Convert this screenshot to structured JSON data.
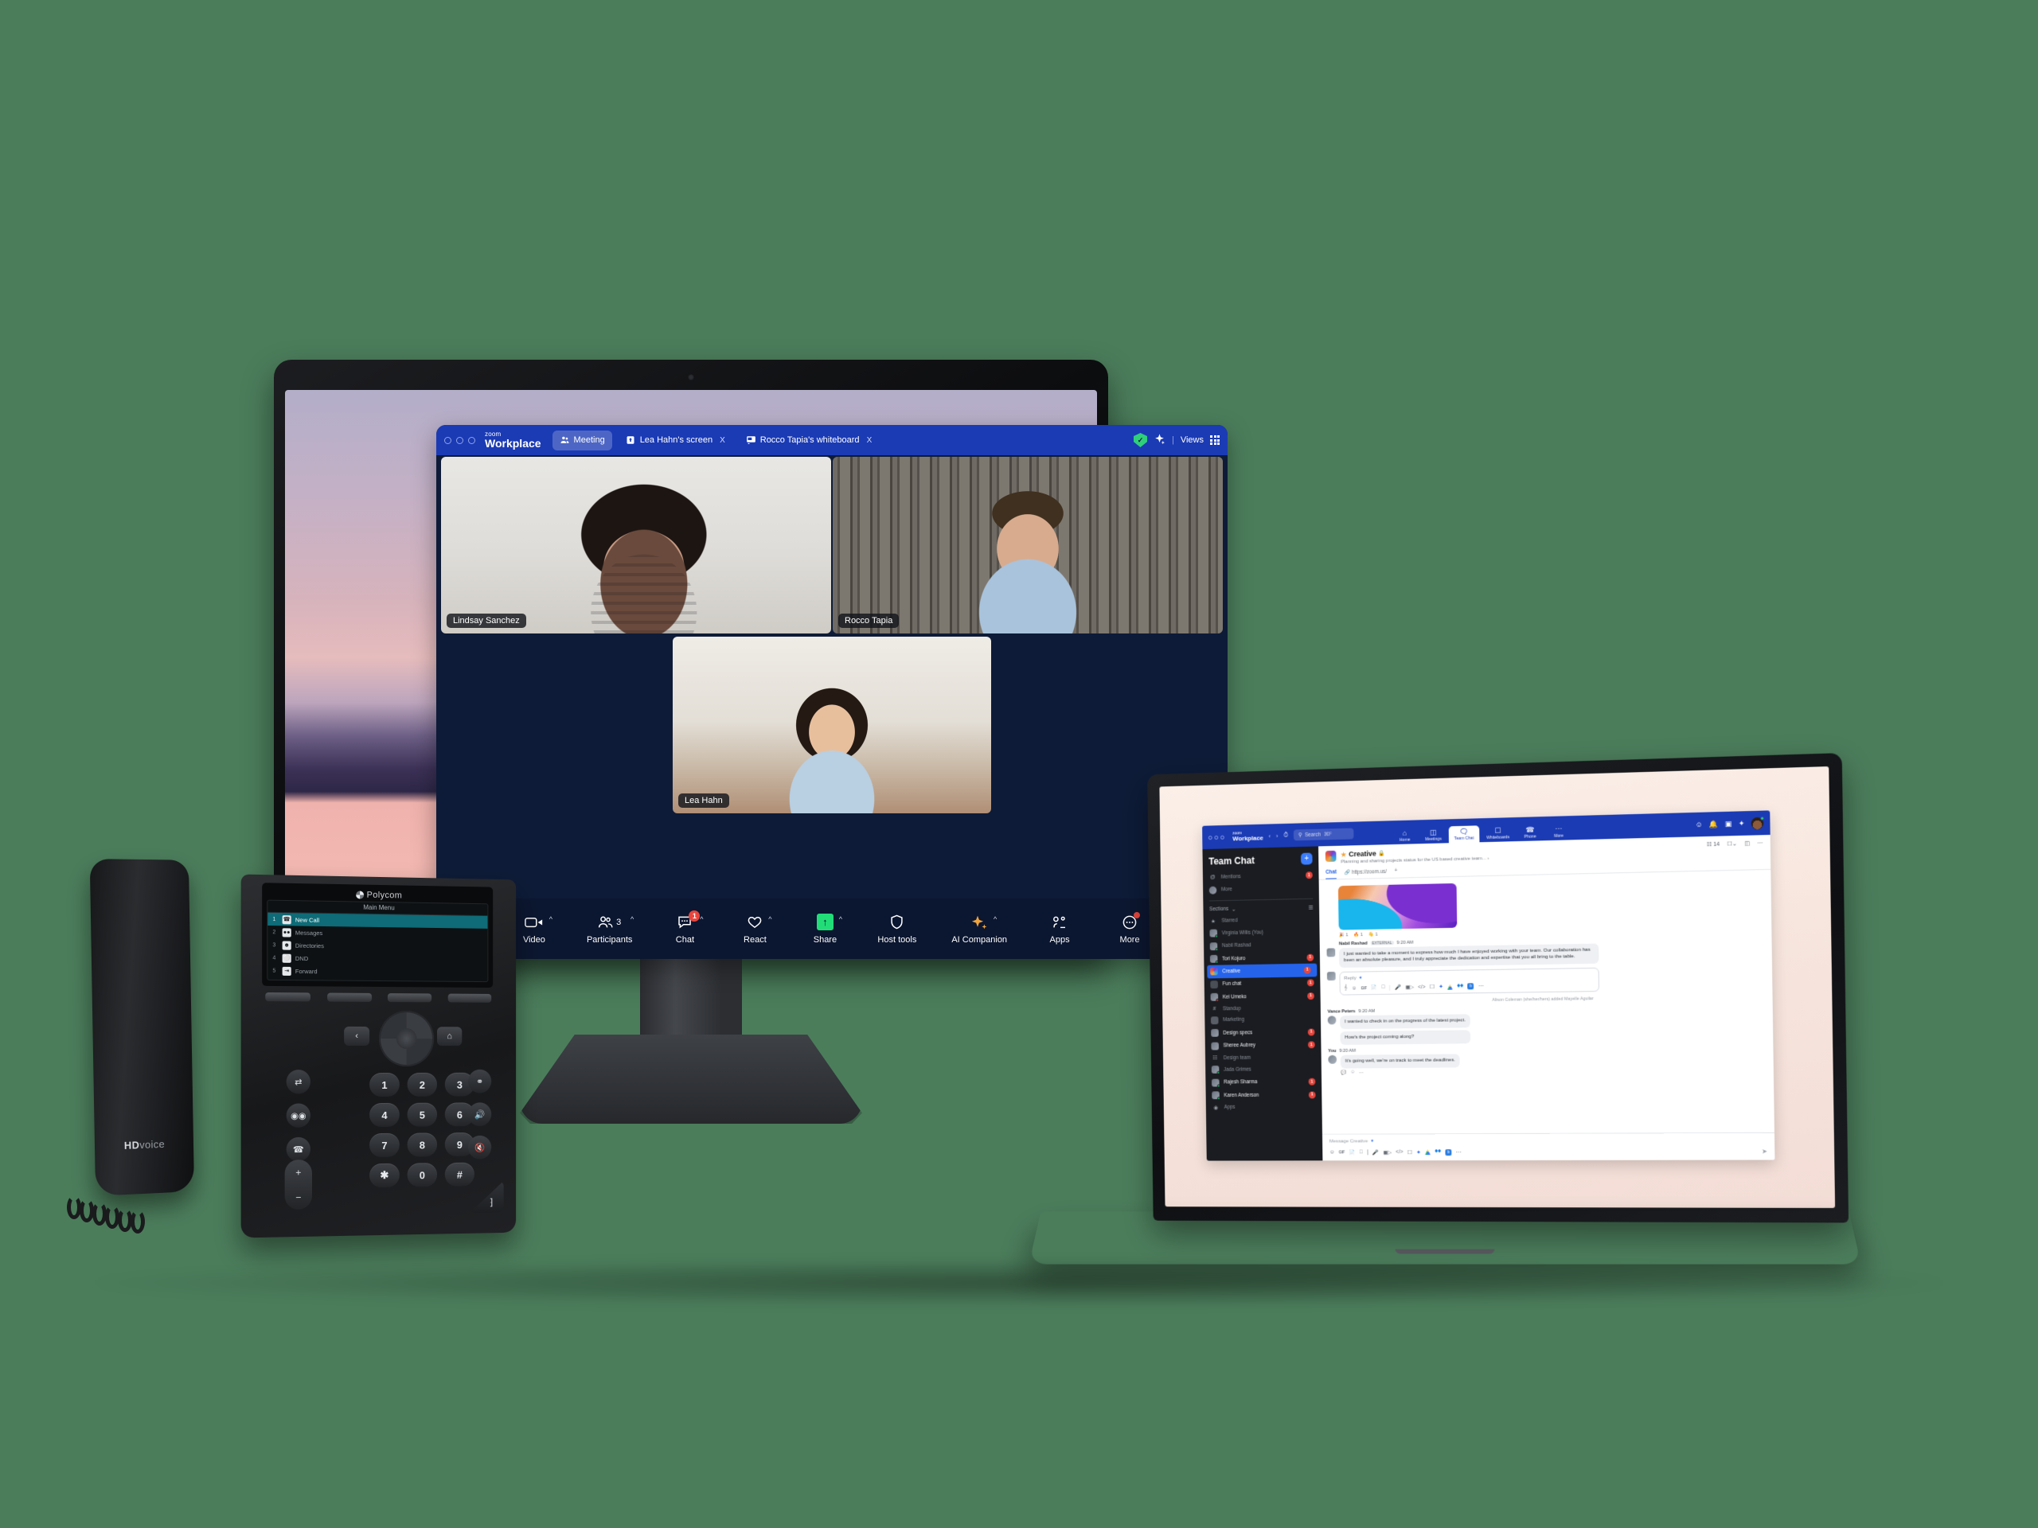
{
  "scene": {
    "background_color": "#4b7d5b",
    "devices": [
      "desktop-monitor",
      "laptop",
      "desk-phone"
    ]
  },
  "monitor": {
    "wallpaper_colors": [
      "#b3aec9",
      "#e6bcbd",
      "#2e2747",
      "#f0b2ad"
    ],
    "zoom_window": {
      "titlebar": {
        "brand_top": "zoom",
        "brand_bottom": "Workplace",
        "tabs": [
          {
            "label": "Meeting",
            "icon": "participants-icon",
            "active": true,
            "closable": false
          },
          {
            "label": "Lea Hahn's screen",
            "icon": "screen-share-icon",
            "active": false,
            "closable": true,
            "close_label": "X"
          },
          {
            "label": "Rocco Tapia's whiteboard",
            "icon": "whiteboard-icon",
            "active": false,
            "closable": true,
            "close_label": "X"
          }
        ],
        "encryption_icon": "shield-check-icon",
        "encryption_glyph": "✓",
        "ai_icon": "ai-companion-sparkle-icon",
        "views_label": "Views",
        "views_icon": "grid-layout-icon"
      },
      "participants": [
        {
          "name": "Lindsay Sanchez",
          "position": "top-left"
        },
        {
          "name": "Rocco Tapia",
          "position": "top-right"
        },
        {
          "name": "Lea Hahn",
          "position": "bottom-center"
        }
      ],
      "toolbar": [
        {
          "label": "Video",
          "icon": "video-camera-icon",
          "caret": "^",
          "badge": null
        },
        {
          "label": "Participants",
          "icon": "participants-icon",
          "count": "3",
          "caret": "^",
          "badge": null
        },
        {
          "label": "Chat",
          "icon": "chat-bubble-icon",
          "caret": "^",
          "badge": "1"
        },
        {
          "label": "React",
          "icon": "heart-icon",
          "caret": "^",
          "badge": null
        },
        {
          "label": "Share",
          "icon": "share-screen-icon",
          "caret": "^",
          "badge": null
        },
        {
          "label": "Host tools",
          "icon": "shield-icon",
          "caret": "",
          "badge": null
        },
        {
          "label": "AI Companion",
          "icon": "ai-companion-sparkle-icon",
          "caret": "^",
          "badge": null
        },
        {
          "label": "Apps",
          "icon": "apps-icon",
          "caret": "",
          "badge": null
        },
        {
          "label": "More",
          "icon": "more-ellipsis-icon",
          "caret": "",
          "badge": "dot"
        }
      ]
    }
  },
  "laptop": {
    "app": {
      "topbar": {
        "brand_top": "zoom",
        "brand_bottom": "Workplace",
        "back_icon": "chevron-left-icon",
        "forward_icon": "chevron-right-icon",
        "history_icon": "clock-history-icon",
        "search_placeholder": "Search",
        "search_shortcut": "⌘F",
        "tabs": [
          {
            "label": "Home",
            "icon": "home-icon",
            "active": false
          },
          {
            "label": "Meetings",
            "icon": "calendar-icon",
            "active": false
          },
          {
            "label": "Team Chat",
            "icon": "team-chat-icon",
            "active": true
          },
          {
            "label": "Whiteboards",
            "icon": "whiteboard-icon",
            "active": false
          },
          {
            "label": "Phone",
            "icon": "phone-icon",
            "active": false
          },
          {
            "label": "More",
            "icon": "more-ellipsis-icon",
            "active": false
          }
        ],
        "right_icons": [
          "contacts-icon",
          "bell-notification-icon",
          "panel-layout-icon",
          "ai-companion-sparkle-icon",
          "user-avatar"
        ]
      },
      "sidebar": {
        "title": "Team Chat",
        "new_chat_label": "+",
        "top_items": [
          {
            "label": "Mentions",
            "icon": "at-mention-icon",
            "badge": "1"
          },
          {
            "label": "More",
            "icon": "more-avatar-icon",
            "badge": null
          }
        ],
        "sections_label": "Sections",
        "sections_caret": "⌄",
        "filter_icon": "filter-icon",
        "items": [
          {
            "label": "Starred",
            "icon": "star-icon",
            "badge": null,
            "selected": false,
            "dim": true
          },
          {
            "label": "Virginia Willis (You)",
            "icon": "avatar",
            "presence": "available",
            "badge": null,
            "selected": false,
            "dim": true
          },
          {
            "label": "Nabil Rashad",
            "icon": "avatar",
            "presence": "available",
            "badge": null,
            "selected": false,
            "dim": true
          },
          {
            "label": "Tori Kojuro",
            "icon": "avatar",
            "presence": "available",
            "badge": "1",
            "selected": false,
            "dim": false
          },
          {
            "label": "Creative",
            "icon": "channel-avatar",
            "badge": "1",
            "selected": true,
            "dim": false
          },
          {
            "label": "Fun chat",
            "icon": "group-icon",
            "badge": "1",
            "selected": false,
            "dim": false
          },
          {
            "label": "Kei Umeko",
            "icon": "avatar",
            "presence": "busy",
            "badge": "1",
            "selected": false,
            "dim": false
          },
          {
            "label": "Standup",
            "icon": "hash-channel-icon",
            "badge": null,
            "selected": false,
            "dim": true
          },
          {
            "label": "Marketing",
            "icon": "folder-icon",
            "badge": null,
            "selected": false,
            "dim": true
          },
          {
            "label": "Design specs",
            "icon": "avatar",
            "badge": "1",
            "selected": false,
            "dim": false
          },
          {
            "label": "Sheree Aubrey",
            "icon": "avatar",
            "badge": "1",
            "selected": false,
            "dim": false
          },
          {
            "label": "Design team",
            "icon": "team-icon",
            "badge": null,
            "selected": false,
            "dim": true
          },
          {
            "label": "Jada Grimes",
            "icon": "avatar",
            "presence": "available",
            "badge": null,
            "selected": false,
            "dim": true
          },
          {
            "label": "Rajesh Sharma",
            "icon": "avatar",
            "presence": "available",
            "badge": "1",
            "selected": false,
            "dim": false
          },
          {
            "label": "Karen Anderson",
            "icon": "avatar",
            "presence": "available",
            "badge": "1",
            "selected": false,
            "dim": false
          },
          {
            "label": "Apps",
            "icon": "apps-icon",
            "badge": null,
            "selected": false,
            "dim": true
          }
        ]
      },
      "channel": {
        "star_icon": "star-icon",
        "name": "Creative",
        "lock_icon": "lock-icon",
        "description": "Planning and sharing projects status for the US based creative team...",
        "description_more": "›",
        "member_icon": "members-icon",
        "member_count": "14",
        "meet_icon": "video-camera-icon",
        "meet_caret": "⌄",
        "calendar_icon": "calendar-icon",
        "more_icon": "more-ellipsis-icon",
        "tabs": [
          {
            "label": "Chat",
            "active": true,
            "icon": null
          },
          {
            "label": "https://zoom.us/",
            "active": false,
            "icon": "link-icon"
          },
          {
            "label": "+",
            "active": false,
            "icon": null
          }
        ],
        "messages": [
          {
            "type": "image",
            "alt": "abstract-gradient-image",
            "reactions": [
              {
                "emoji": "🎉",
                "count": "1"
              },
              {
                "emoji": "🔥",
                "count": "1"
              },
              {
                "emoji": "👋",
                "count": "1"
              }
            ]
          },
          {
            "type": "text",
            "author": "Nabil Rashad",
            "tag": "EXTERNAL",
            "time": "9:20 AM",
            "text": "I just wanted to take a moment to express how much I have enjoyed working with your team. Our collaboration has been an absolute pleasure, and I truly appreciate the dedication and expertise that you all bring to the table."
          }
        ],
        "reply_box": {
          "placeholder": "Reply",
          "ai_icon": "ai-companion-sparkle-icon",
          "tools": [
            "format-text-icon",
            "emoji-icon",
            "gif-icon",
            "file-icon",
            "screenshot-icon",
            "audio-message-icon",
            "video-message-icon",
            "code-snippet-icon",
            "screen-share-icon",
            "ai-companion-sparkle-icon",
            "google-drive-icon",
            "dropbox-icon",
            "box-icon",
            "more-ellipsis-icon"
          ]
        },
        "system_message": "Alison Coleman (she/her/hers) added Mayelle Aguilar",
        "thread": [
          {
            "author": "Vance Peters",
            "time": "9:20 AM",
            "texts": [
              "I wanted to check in on the progress of the latest project.",
              "How's the project coming along?"
            ]
          },
          {
            "author": "You",
            "time": "9:20 AM",
            "texts": [
              "It's going well, we're on track to meet the deadlines."
            ],
            "actions": [
              "reply-icon",
              "add-reaction-icon",
              "more-ellipsis-icon"
            ]
          }
        ],
        "composer": {
          "placeholder": "Message Creative",
          "ai_icon": "ai-companion-sparkle-icon",
          "tools": [
            "emoji-icon",
            "gif-icon",
            "file-icon",
            "screenshot-icon",
            "audio-message-icon",
            "video-message-icon",
            "code-snippet-icon",
            "screen-share-icon",
            "ai-companion-sparkle-icon",
            "google-drive-icon",
            "dropbox-icon",
            "box-icon",
            "more-ellipsis-icon"
          ],
          "send_icon": "send-icon"
        }
      }
    }
  },
  "phone": {
    "brand": "Polycom",
    "handset_label_bold": "HD",
    "handset_label_rest": "voice",
    "lcd": {
      "title": "Main Menu",
      "items": [
        {
          "num": "1",
          "label": "New Call",
          "icon": "handset-icon",
          "selected": true
        },
        {
          "num": "2",
          "label": "Messages",
          "icon": "voicemail-icon",
          "selected": false
        },
        {
          "num": "3",
          "label": "Directories",
          "icon": "directory-icon",
          "selected": false
        },
        {
          "num": "4",
          "label": "DND",
          "icon": "dnd-icon",
          "selected": false
        },
        {
          "num": "5",
          "label": "Forward",
          "icon": "forward-icon",
          "selected": false
        }
      ]
    },
    "keypad": [
      "1",
      "2",
      "3",
      "4",
      "5",
      "6",
      "7",
      "8",
      "9",
      "✱",
      "0",
      "#"
    ],
    "function_keys": [
      "transfer-icon",
      "voicemail-icon",
      "hold-icon"
    ],
    "nav_left_icon": "‹",
    "nav_home_icon": "⌂",
    "volume_up": "+",
    "volume_down": "−",
    "right_keys": [
      "headset-icon",
      "speaker-icon",
      "mute-icon"
    ]
  }
}
